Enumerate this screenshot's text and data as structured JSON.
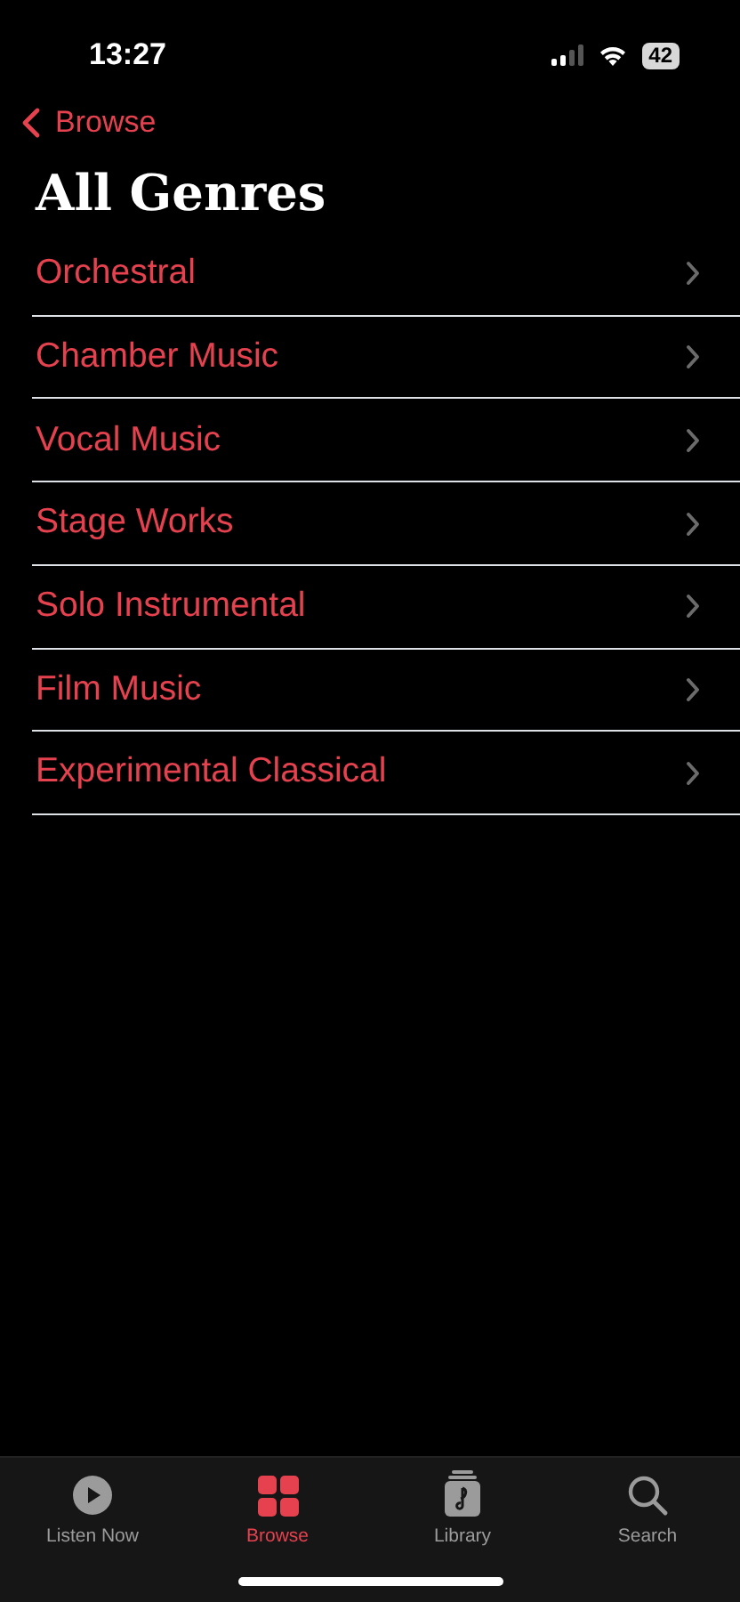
{
  "status_bar": {
    "time": "13:27",
    "battery": "42"
  },
  "nav": {
    "back_label": "Browse"
  },
  "title": "All Genres",
  "genres": [
    {
      "label": "Orchestral"
    },
    {
      "label": "Chamber Music"
    },
    {
      "label": "Vocal Music"
    },
    {
      "label": "Stage Works"
    },
    {
      "label": "Solo Instrumental"
    },
    {
      "label": "Film Music"
    },
    {
      "label": "Experimental Classical"
    }
  ],
  "tab_bar": [
    {
      "kind": "listen",
      "label": "Listen Now",
      "selected": false
    },
    {
      "kind": "browse",
      "label": "Browse",
      "selected": true
    },
    {
      "kind": "library",
      "label": "Library",
      "selected": false
    },
    {
      "kind": "search",
      "label": "Search",
      "selected": false
    }
  ]
}
